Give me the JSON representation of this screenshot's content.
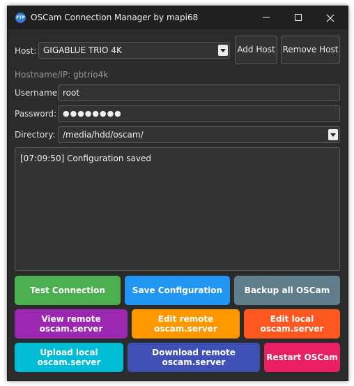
{
  "window": {
    "title": "OSCam Connection Manager by mapi68",
    "icon_text": "FTP",
    "icons": [
      "minimize-icon",
      "maximize-icon",
      "close-icon"
    ]
  },
  "host": {
    "label": "Host:",
    "selected": "GIGABLUE TRIO 4K",
    "add_label": "Add Host",
    "remove_label": "Remove Host"
  },
  "hostname": {
    "label": "Hostname/IP: gbtrio4k"
  },
  "username": {
    "label": "Username:",
    "value": "root"
  },
  "password": {
    "label": "Password:",
    "value": "●●●●●●●●"
  },
  "directory": {
    "label": "Directory:",
    "value": "/media/hdd/oscam/"
  },
  "log": {
    "line": "[07:09:50] Configuration saved"
  },
  "buttons": {
    "test": "Test Connection",
    "save": "Save Configuration",
    "backup": "Backup all OSCam",
    "view_remote": "View remote oscam.server",
    "edit_remote": "Edit remote oscam.server",
    "edit_local": "Edit local oscam.server",
    "upload_local": "Upload local oscam.server",
    "download_remote": "Download remote oscam.server",
    "restart": "Restart OSCam"
  },
  "colors": {
    "test": "#4caf50",
    "save": "#2196f3",
    "backup": "#607d8b",
    "view_remote": "#9c27b0",
    "edit_remote": "#ff9800",
    "edit_local": "#ff5722",
    "upload_local": "#00bcd4",
    "download_remote": "#3f51b5",
    "restart": "#e91e63"
  }
}
